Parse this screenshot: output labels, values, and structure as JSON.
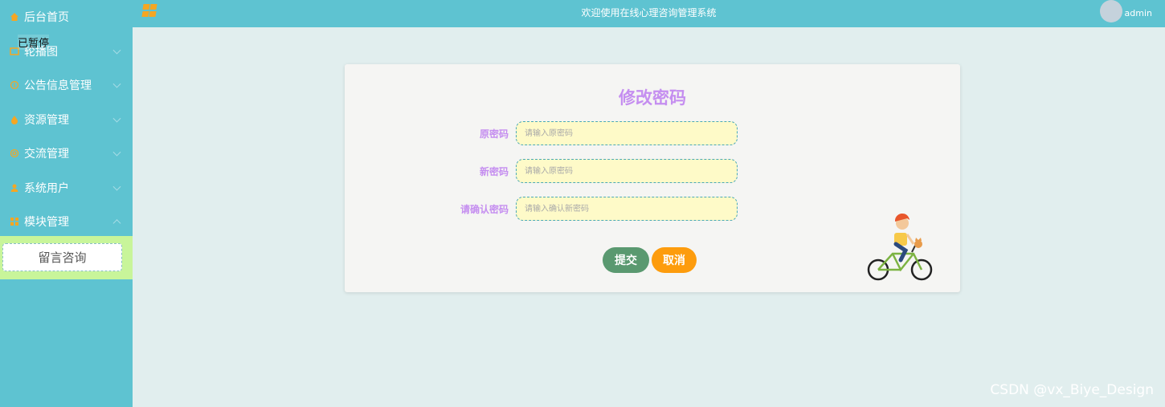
{
  "header": {
    "title": "欢迎使用在线心理咨询管理系统",
    "user": "admin"
  },
  "sidebar": {
    "items": [
      {
        "label": "后台首页",
        "icon": "home-icon"
      },
      {
        "label": "轮播图",
        "icon": "image-icon"
      },
      {
        "label": "公告信息管理",
        "icon": "info-icon"
      },
      {
        "label": "资源管理",
        "icon": "drop-icon"
      },
      {
        "label": "交流管理",
        "icon": "settings-icon"
      },
      {
        "label": "系统用户",
        "icon": "user-icon"
      },
      {
        "label": "模块管理",
        "icon": "grid-icon"
      }
    ],
    "submenu": [
      "留言咨询"
    ],
    "overlay_text": "已暂停"
  },
  "form": {
    "title": "修改密码",
    "fields": [
      {
        "label": "原密码",
        "placeholder": "请输入原密码"
      },
      {
        "label": "新密码",
        "placeholder": "请输入原密码"
      },
      {
        "label": "请确认密码",
        "placeholder": "请输入确认新密码"
      }
    ],
    "submit_label": "提交",
    "cancel_label": "取消"
  },
  "watermark": "CSDN @vx_Biye_Design",
  "colors": {
    "sidebar": "#5ec3d1",
    "submenu_bg": "#c8f59a",
    "title_purple": "#c58ef0",
    "input_bg": "#fefac8",
    "submit": "#5a9970",
    "cancel": "#fd9c0d"
  }
}
